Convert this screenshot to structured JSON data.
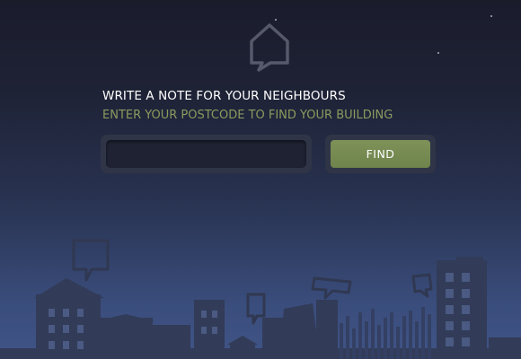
{
  "header": {
    "logo_icon": "house-speech-bubble-icon"
  },
  "main": {
    "headline": "WRITE A NOTE FOR YOUR NEIGHBOURS",
    "subline": "ENTER YOUR POSTCODE TO FIND YOUR BUILDING",
    "postcode_input": {
      "value": "",
      "placeholder": ""
    },
    "find_label": "FIND"
  },
  "illustration": {
    "icon": "city-skyline-illustration"
  },
  "colors": {
    "background_top": "#1a1c2c",
    "background_bottom": "#405487",
    "accent": "#7d9158",
    "subline": "#8d9a5e",
    "skyline": "#323b58"
  }
}
